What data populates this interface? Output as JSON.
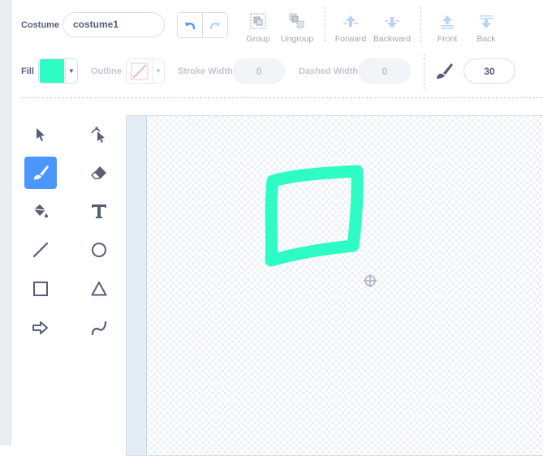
{
  "costume": {
    "label": "Costume",
    "name_value": "costume1"
  },
  "toolbar": {
    "group_label": "Group",
    "ungroup_label": "Ungroup",
    "forward_label": "Forward",
    "backward_label": "Backward",
    "front_label": "Front",
    "back_label": "Back"
  },
  "props": {
    "fill_label": "Fill",
    "fill_color": "#2dfcc4",
    "outline_label": "Outline",
    "stroke_width_label": "Stroke Width",
    "stroke_width_value": "0",
    "dashed_width_label": "Dashed Width",
    "dashed_width_value": "0",
    "brush_size_value": "30"
  },
  "tools": [
    "select-tool",
    "reshape-tool",
    "brush-tool",
    "eraser-tool",
    "fill-tool",
    "text-tool",
    "line-tool",
    "circle-tool",
    "rectangle-tool",
    "triangle-tool",
    "arrow-tool",
    "curve-tool"
  ],
  "selected_tool": "brush-tool",
  "colors": {
    "accent": "#4c97ff",
    "stroke": "#2dfcc4",
    "text": "#575e75"
  }
}
